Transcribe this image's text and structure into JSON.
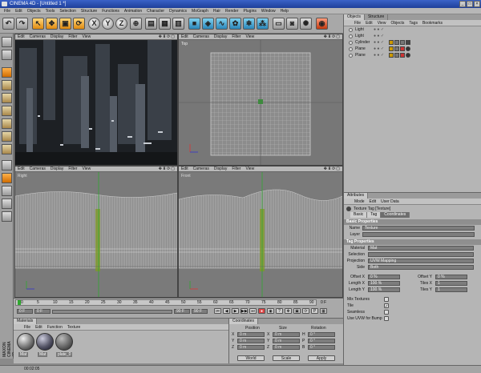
{
  "window": {
    "title": "CINEMA 4D - [Untitled 1 *]"
  },
  "menu": [
    "File",
    "Edit",
    "Objects",
    "Tools",
    "Selection",
    "Structure",
    "Functions",
    "Animation",
    "Character",
    "Dynamics",
    "MoGraph",
    "Hair",
    "Render",
    "Plugins",
    "Window",
    "Help"
  ],
  "toolbar": {
    "x_label": "X",
    "y_label": "Y",
    "z_label": "Z"
  },
  "viewport_menu": [
    "Edit",
    "Cameras",
    "Display",
    "Filter",
    "View"
  ],
  "viewports": {
    "top": "Top",
    "right": "Right",
    "front": "Front"
  },
  "object_manager": {
    "tabs": [
      "Objects",
      "Structure"
    ],
    "menu": [
      "File",
      "Edit",
      "View",
      "Objects",
      "Tags",
      "Bookmarks"
    ],
    "objects": [
      "Light",
      "Light",
      "Cylinder",
      "Plane",
      "Plane"
    ]
  },
  "attributes": {
    "header": "Attributes",
    "menu": [
      "Mode",
      "Edit",
      "User Data"
    ],
    "title": "Texture Tag [Texture]",
    "tabs": [
      "Basic",
      "Tag",
      "Coordinates"
    ],
    "basic_section": "Basic Properties",
    "name_label": "Name",
    "name_value": "Texture",
    "layer_label": "Layer",
    "tag_section": "Tag Properties",
    "material_label": "Material",
    "material_value": "Mat",
    "selection_label": "Selection",
    "projection_label": "Projection",
    "projection_value": "UVW Mapping",
    "side_label": "Side",
    "side_value": "Both",
    "offset_x_label": "Offset X",
    "offset_x_value": "0 %",
    "offset_y_label": "Offset Y",
    "offset_y_value": "0 %",
    "length_x_label": "Length X",
    "length_x_value": "100 %",
    "tiles_x_label": "Tiles X",
    "tiles_x_value": "1",
    "length_y_label": "Length Y",
    "length_y_value": "100 %",
    "tiles_y_label": "Tiles Y",
    "tiles_y_value": "1",
    "mix_label": "Mix Textures",
    "tile_label": "Tile",
    "seamless_label": "Seamless",
    "uvw_bump_label": "Use UVW for Bump"
  },
  "timeline": {
    "ticks": [
      "0",
      "5",
      "10",
      "15",
      "20",
      "25",
      "30",
      "35",
      "40",
      "45",
      "50",
      "55",
      "60",
      "65",
      "70",
      "75",
      "80",
      "85",
      "90"
    ],
    "current_frame": "0 F",
    "end_frame": "90 F",
    "start_frame": "0 F",
    "max_frame": "0 F"
  },
  "materials": {
    "header": "Materials",
    "menu": [
      "File",
      "Edit",
      "Function",
      "Texture"
    ],
    "items": [
      "Mat",
      "Mat",
      "plate_0"
    ]
  },
  "coordinates": {
    "header": "Coordinates",
    "position_header": "Position",
    "size_header": "Size",
    "rotation_header": "Rotation",
    "x_label": "X",
    "y_label": "Y",
    "z_label": "Z",
    "h_label": "H",
    "p_label": "P",
    "b_label": "B",
    "zero_m": "0 m",
    "zero_deg": "0 °",
    "world": "World",
    "scale": "Scale",
    "apply": "Apply"
  },
  "status": {
    "time": "00:02:05"
  },
  "brand": {
    "vertical": "MAXON CINEMA 4D"
  },
  "colors": {
    "accent_orange": "#e08a10",
    "title_blue": "#1e3f9a",
    "axis_green": "#2fa82f"
  }
}
